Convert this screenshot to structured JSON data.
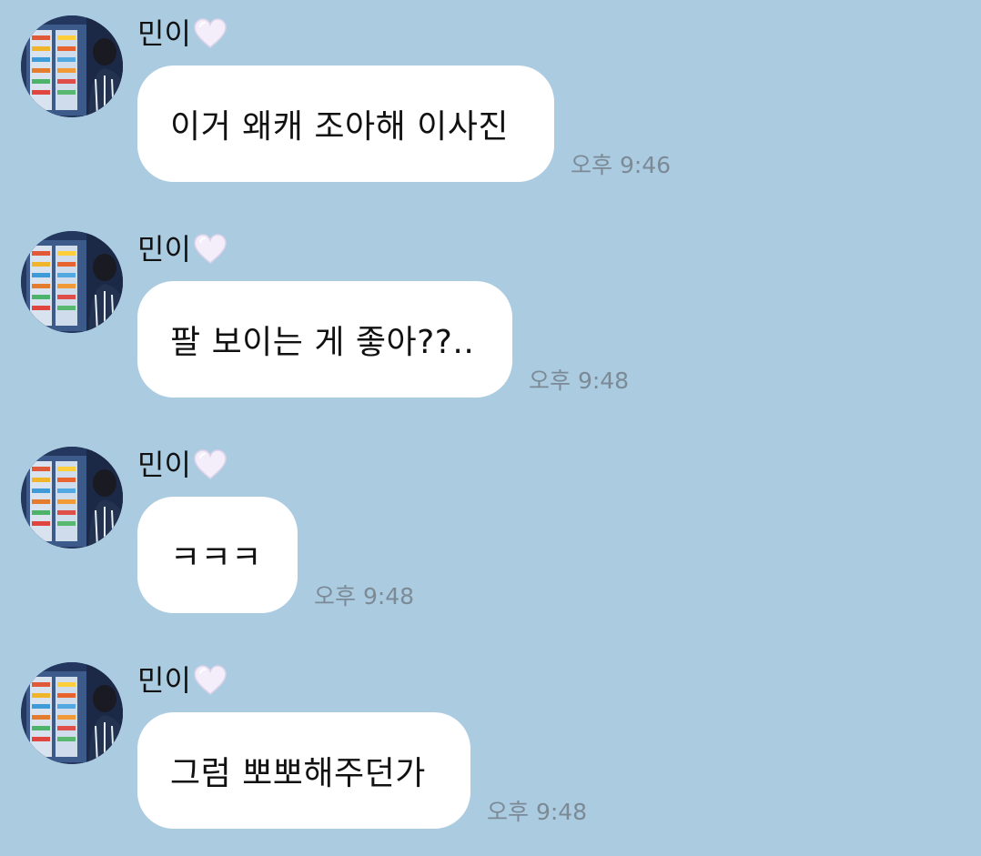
{
  "chat": {
    "messages": [
      {
        "sender": "민이",
        "text": "이거 왜캐 조아해 이사진",
        "time": "오후 9:46"
      },
      {
        "sender": "민이",
        "text": "팔 보이는 게 좋아??..",
        "time": "오후 9:48"
      },
      {
        "sender": "민이",
        "text": "ㅋㅋㅋ",
        "time": "오후 9:48"
      },
      {
        "sender": "민이",
        "text": "그럼 뽀뽀해주던가",
        "time": "오후 9:48"
      }
    ]
  },
  "colors": {
    "background": "#abcbe1",
    "bubble": "#ffffff",
    "timestamp": "#7c8a96",
    "heart": "#f1ebf8"
  },
  "icons": {
    "sender_badge": "white-heart-icon",
    "avatar": "profile-photo"
  }
}
